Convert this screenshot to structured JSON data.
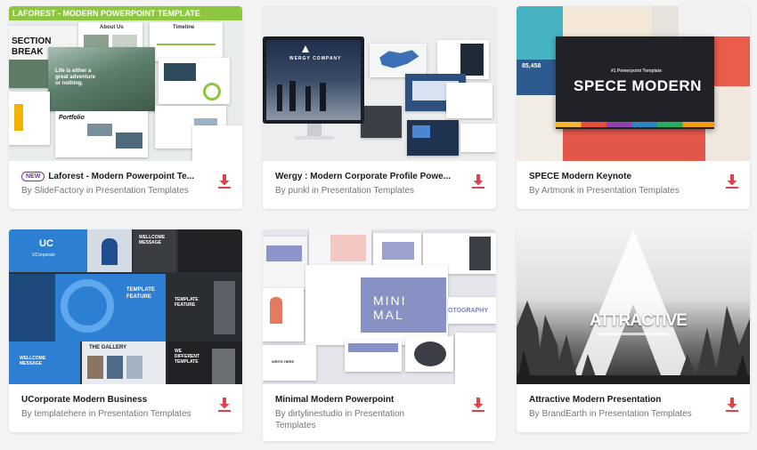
{
  "cards": [
    {
      "title": "Laforest - Modern Powerpoint Te...",
      "badge": "NEW",
      "author": "SlideFactory",
      "category": "Presentation Templates",
      "thumb_text": {
        "banner": "LAFOREST - MODERN POWERPOINT TEMPLATE",
        "section": "SECTION",
        "break": "BREAK",
        "about": "About Us",
        "timeline": "Timeline",
        "tagline": "Life is either a great adventure or nothing.",
        "portfolio": "Portfolio"
      }
    },
    {
      "title": "Wergy : Modern Corporate Profile Powe...",
      "author": "punkl",
      "category": "Presentation Templates",
      "thumb_text": {
        "company": "WERGY COMPANY"
      }
    },
    {
      "title": "SPECE Modern Keynote",
      "author": "Artmonk",
      "category": "Presentation Templates",
      "thumb_text": {
        "small": "#1 Powerpoint Template",
        "big": "SPECE MODERN",
        "stat": "85,458"
      }
    },
    {
      "title": "UCorporate Modern Business",
      "author": "templatehere",
      "category": "Presentation Templates",
      "thumb_text": {
        "logo": "UC",
        "brand": "UCorporate",
        "welcome": "WELLCOME MESSAGE",
        "feature": "TEMPLATE FEATURE",
        "gallery": "THE GALLERY",
        "different": "WE DIFFERENT TEMPLATE",
        "welcome2": "WELLCOME MESSAGE",
        "template2": "TEMPLATE FEATURE"
      }
    },
    {
      "title": "Minimal Modern Powerpoint",
      "author": "dirtylinestudio",
      "category": "Presentation Templates",
      "thumb_text": {
        "mini": "MINI",
        "mal": "MAL",
        "photo": "OTOGRAPHY",
        "write": "WRITE HERE"
      }
    },
    {
      "title": "Attractive Modern Presentation",
      "author": "BrandEarth",
      "category": "Presentation Templates",
      "thumb_text": {
        "word": "ATTRACTIVE"
      }
    }
  ],
  "by_label": "By",
  "in_label": "in",
  "icons": {
    "download": "download-icon"
  },
  "colors": {
    "download": "#e0424d",
    "badge": "#7b2fa8"
  }
}
